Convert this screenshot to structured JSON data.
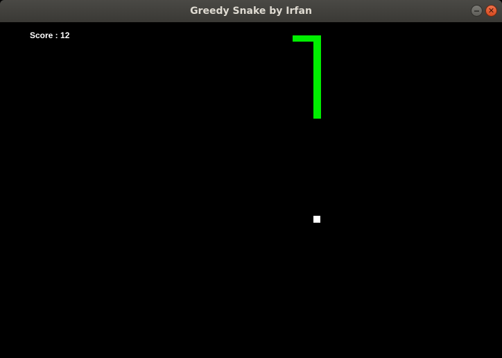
{
  "window": {
    "title": "Greedy Snake by Irfan",
    "minimize_glyph": "",
    "close_glyph": "✕"
  },
  "game": {
    "score_text": "Score : 12",
    "score": 12,
    "snake_color": "#00ee00",
    "food_color": "#ffffff",
    "background_color": "#000000"
  },
  "icons": {
    "minimize": "minimize-icon",
    "close": "close-icon"
  }
}
